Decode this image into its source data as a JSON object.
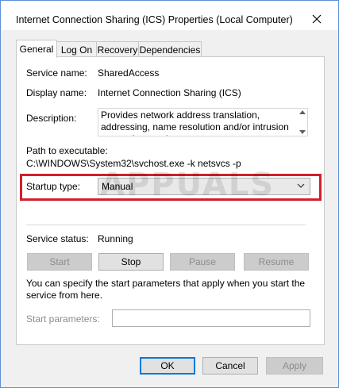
{
  "window": {
    "title": "Internet Connection Sharing (ICS) Properties (Local Computer)"
  },
  "tabs": [
    {
      "label": "General",
      "active": true
    },
    {
      "label": "Log On",
      "active": false
    },
    {
      "label": "Recovery",
      "active": false
    },
    {
      "label": "Dependencies",
      "active": false
    }
  ],
  "general": {
    "service_name_label": "Service name:",
    "service_name_value": "SharedAccess",
    "display_name_label": "Display name:",
    "display_name_value": "Internet Connection Sharing (ICS)",
    "description_label": "Description:",
    "description_value": "Provides network address translation, addressing, name resolution and/or intrusion prevention services",
    "path_label": "Path to executable:",
    "path_value": "C:\\WINDOWS\\System32\\svchost.exe -k netsvcs -p",
    "startup_type_label": "Startup type:",
    "startup_type_value": "Manual",
    "service_status_label": "Service status:",
    "service_status_value": "Running",
    "buttons": {
      "start": "Start",
      "stop": "Stop",
      "pause": "Pause",
      "resume": "Resume"
    },
    "info_text": "You can specify the start parameters that apply when you start the service from here.",
    "start_params_label": "Start parameters:",
    "start_params_value": ""
  },
  "footer": {
    "ok": "OK",
    "cancel": "Cancel",
    "apply": "Apply"
  },
  "watermark": "APPUALS",
  "colors": {
    "highlight": "#d21f2b",
    "default_button": "#0078d7"
  }
}
